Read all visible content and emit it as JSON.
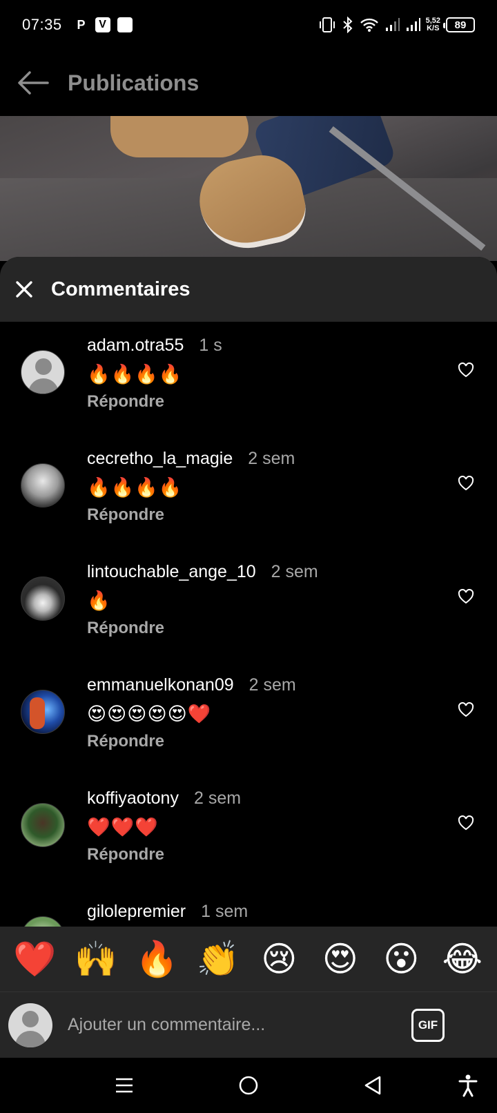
{
  "status_bar": {
    "time": "07:35",
    "app_icons": [
      "P",
      "V",
      ""
    ],
    "net_speed_value": "5,52",
    "net_speed_unit": "K/S",
    "battery": "89"
  },
  "header": {
    "back_icon": "arrow-left-icon",
    "title": "Publications"
  },
  "sheet": {
    "close_icon": "close-icon",
    "title": "Commentaires"
  },
  "comments": [
    {
      "username": "adam.otra55",
      "time": "1 s",
      "text": "🔥🔥🔥🔥",
      "reply": "Répondre"
    },
    {
      "username": "cecretho_la_magie",
      "time": "2 sem",
      "text": "🔥🔥🔥🔥",
      "reply": "Répondre"
    },
    {
      "username": "lintouchable_ange_10",
      "time": "2 sem",
      "text": "🔥",
      "reply": "Répondre"
    },
    {
      "username": "emmanuelkonan09",
      "time": "2 sem",
      "text": "😍😍😍😍😍❤️",
      "reply": "Répondre"
    },
    {
      "username": "koffiyaotony",
      "time": "2 sem",
      "text": "❤️❤️❤️",
      "reply": "Répondre"
    },
    {
      "username": "gilolepremier",
      "time": "1 sem",
      "text": "",
      "reply": ""
    }
  ],
  "emoji_bar": [
    "❤️",
    "🙌",
    "🔥",
    "👏",
    "😢",
    "😍",
    "😮",
    "😂"
  ],
  "input": {
    "placeholder": "Ajouter un commentaire...",
    "gif_label": "GIF"
  },
  "colors": {
    "background": "#000000",
    "sheet_header": "#262626",
    "secondary_text": "#a8a8a8",
    "header_title": "#8e8e8e"
  }
}
